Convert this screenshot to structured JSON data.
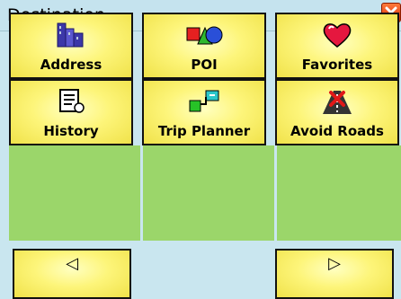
{
  "window": {
    "title": "Destination",
    "close_symbol": "✕"
  },
  "tiles": [
    {
      "label": "Address",
      "icon": "address-icon"
    },
    {
      "label": "POI",
      "icon": "poi-icon"
    },
    {
      "label": "Favorites",
      "icon": "favorites-icon"
    },
    {
      "label": "History",
      "icon": "history-icon"
    },
    {
      "label": "Trip Planner",
      "icon": "trip-planner-icon"
    },
    {
      "label": "Avoid Roads",
      "icon": "avoid-roads-icon"
    }
  ],
  "nav": {
    "prev_symbol": "◁",
    "next_symbol": "▷"
  },
  "colors": {
    "tile_yellow": "#fdf57a",
    "empty_green": "#9bd66a",
    "background": "#c9e6ef",
    "close_red": "#e0401a"
  }
}
